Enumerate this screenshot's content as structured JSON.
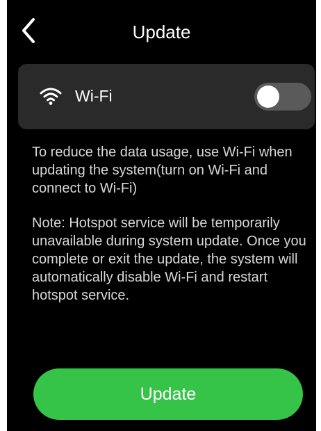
{
  "header": {
    "title": "Update",
    "back_icon": "chevron-left-icon"
  },
  "wifi": {
    "icon": "wifi-icon",
    "label": "Wi-Fi",
    "enabled": false
  },
  "info": {
    "paragraph_1": "To reduce the data usage, use Wi-Fi when updating the system(turn on Wi-Fi and connect to Wi-Fi)",
    "paragraph_2": "Note: Hotspot service will be temporarily unavailable during system update. Once you complete or exit the update, the system will automatically disable Wi-Fi and restart hotspot service."
  },
  "actions": {
    "update_label": "Update"
  },
  "colors": {
    "background": "#000000",
    "card": "#2a2a2a",
    "accent_green": "#35c448",
    "toggle_off_track": "#5a5a5a",
    "body_text": "#d8d8d8"
  }
}
